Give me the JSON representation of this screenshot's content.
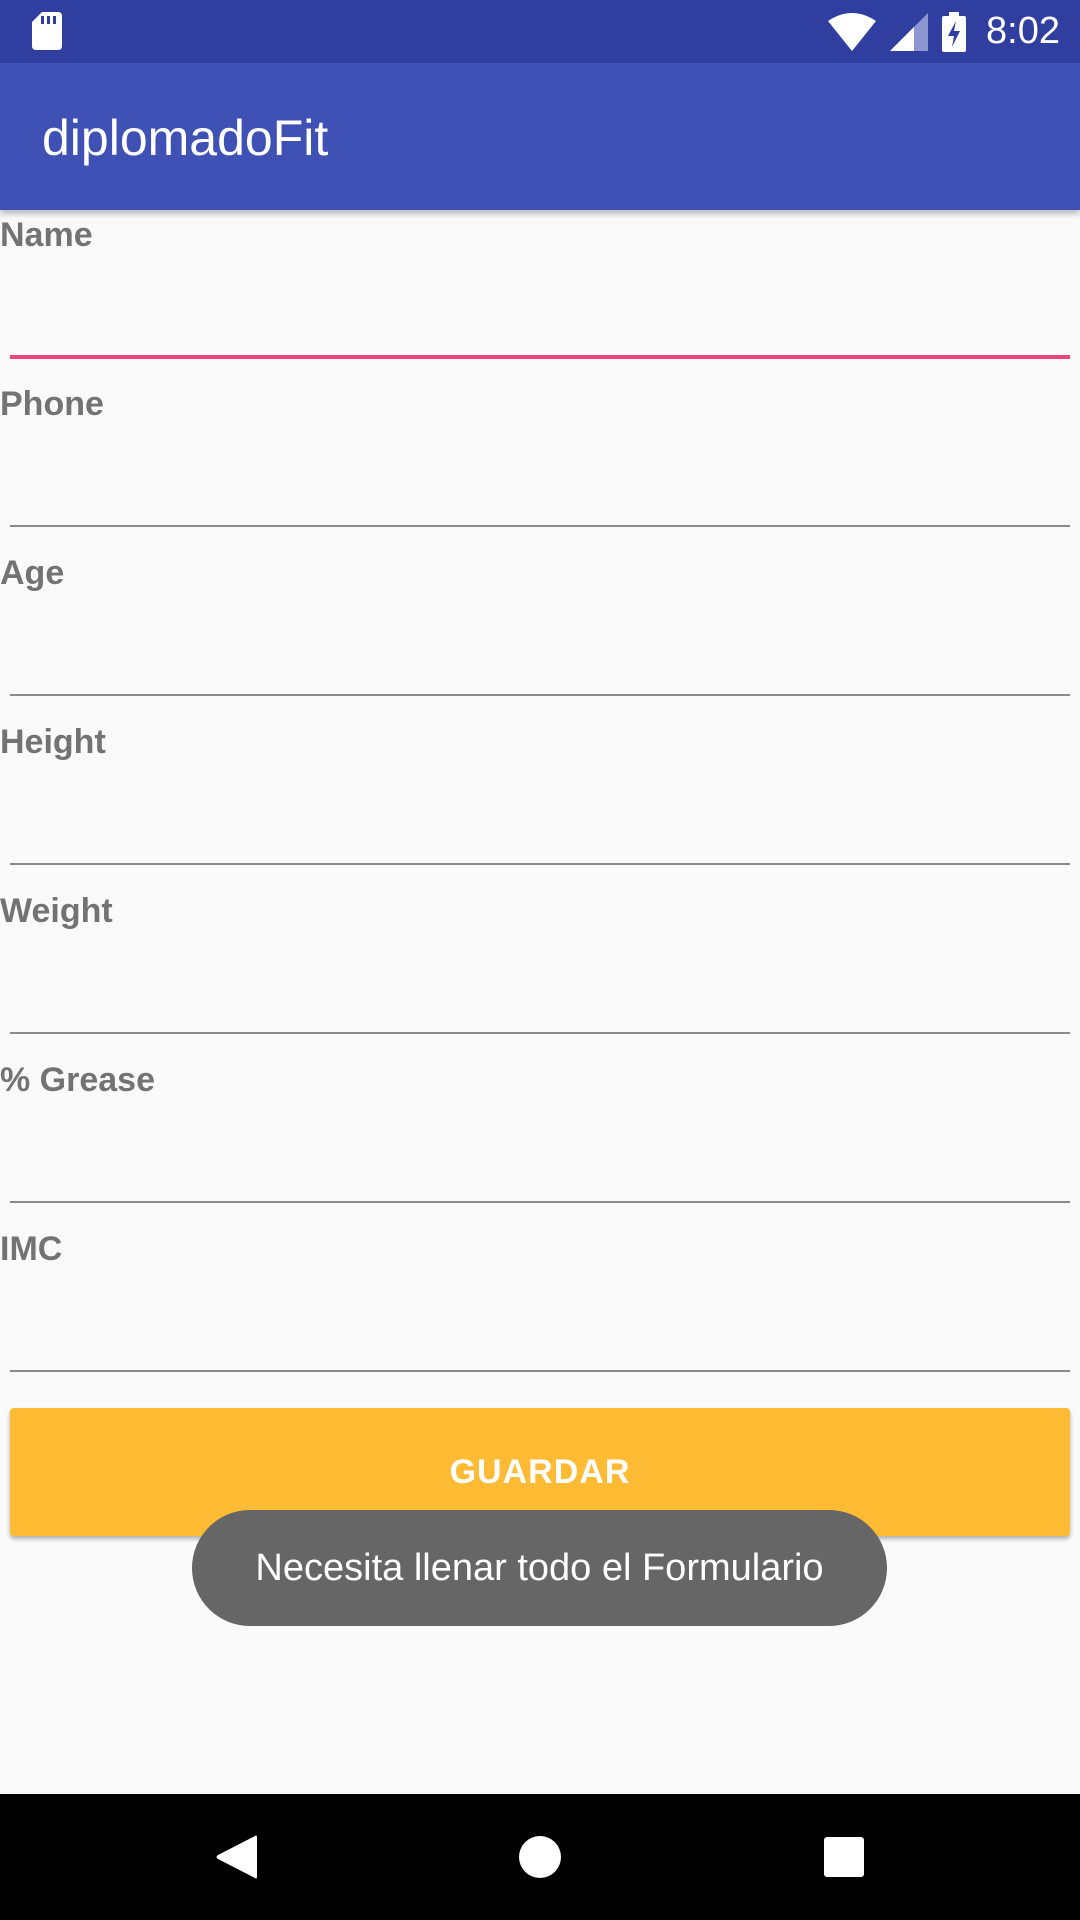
{
  "status_bar": {
    "time": "8:02",
    "icons": [
      "sd-card-icon",
      "wifi-icon",
      "signal-icon",
      "battery-charging-icon"
    ]
  },
  "app_bar": {
    "title": "diplomadoFit"
  },
  "form": {
    "fields": [
      {
        "label": "Name",
        "value": ""
      },
      {
        "label": "Phone",
        "value": ""
      },
      {
        "label": "Age",
        "value": ""
      },
      {
        "label": "Height",
        "value": ""
      },
      {
        "label": "Weight",
        "value": ""
      },
      {
        "label": "% Grease",
        "value": ""
      },
      {
        "label": "IMC",
        "value": ""
      }
    ],
    "save_label": "GUARDAR"
  },
  "toast": {
    "message": "Necesita llenar todo el Formulario"
  },
  "nav_bar": {
    "icons": [
      "back-icon",
      "home-icon",
      "recents-icon"
    ]
  },
  "colors": {
    "status_bar": "#303f9f",
    "app_bar": "#3f51b5",
    "accent": "#e8457a",
    "button": "#ffbb33",
    "label": "#737373",
    "toast": "#666666"
  }
}
